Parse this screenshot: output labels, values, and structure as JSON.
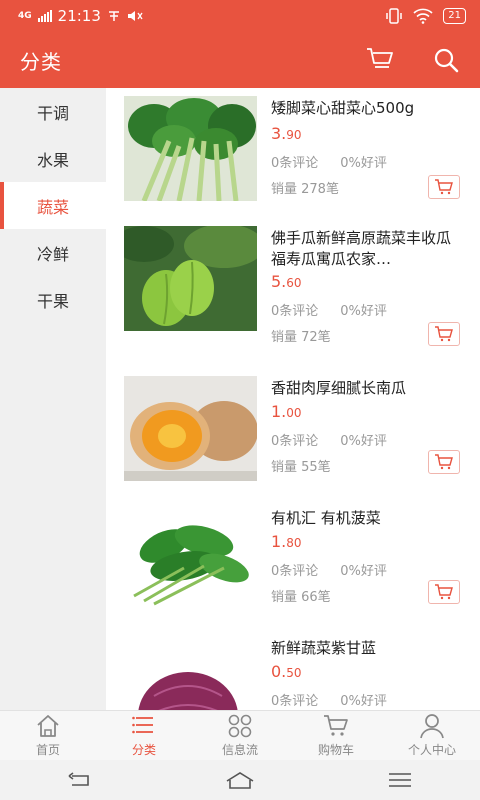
{
  "status_bar": {
    "network": "4G",
    "time": "21:13",
    "battery": "21"
  },
  "header": {
    "title": "分类"
  },
  "sidebar": {
    "items": [
      {
        "label": "干调"
      },
      {
        "label": "水果"
      },
      {
        "label": "蔬菜"
      },
      {
        "label": "冷鲜"
      },
      {
        "label": "干果"
      }
    ],
    "active_index": 2
  },
  "products": [
    {
      "name": "矮脚菜心甜菜心500g",
      "price_int": "3.",
      "price_dec": "90",
      "reviews": "0条评论",
      "positive": "0%好评",
      "sales": "销量 278笔"
    },
    {
      "name": "佛手瓜新鲜高原蔬菜丰收瓜福寿瓜寓瓜农家…",
      "price_int": "5.",
      "price_dec": "60",
      "reviews": "0条评论",
      "positive": "0%好评",
      "sales": "销量 72笔"
    },
    {
      "name": "香甜肉厚细腻长南瓜",
      "price_int": "1.",
      "price_dec": "00",
      "reviews": "0条评论",
      "positive": "0%好评",
      "sales": "销量 55笔"
    },
    {
      "name": "有机汇 有机菠菜",
      "price_int": "1.",
      "price_dec": "80",
      "reviews": "0条评论",
      "positive": "0%好评",
      "sales": "销量 66笔"
    },
    {
      "name": "新鲜蔬菜紫甘蓝",
      "price_int": "0.",
      "price_dec": "50",
      "reviews": "0条评论",
      "positive": "0%好评",
      "sales": ""
    }
  ],
  "tabbar": {
    "items": [
      {
        "label": "首页",
        "icon": "home-icon"
      },
      {
        "label": "分类",
        "icon": "list-icon"
      },
      {
        "label": "信息流",
        "icon": "grid-icon"
      },
      {
        "label": "购物车",
        "icon": "cart-icon"
      },
      {
        "label": "个人中心",
        "icon": "user-icon"
      }
    ],
    "active_index": 1
  },
  "colors": {
    "accent": "#e8533f",
    "sidebar_bg": "#f0f0f0",
    "muted_text": "#999999"
  }
}
